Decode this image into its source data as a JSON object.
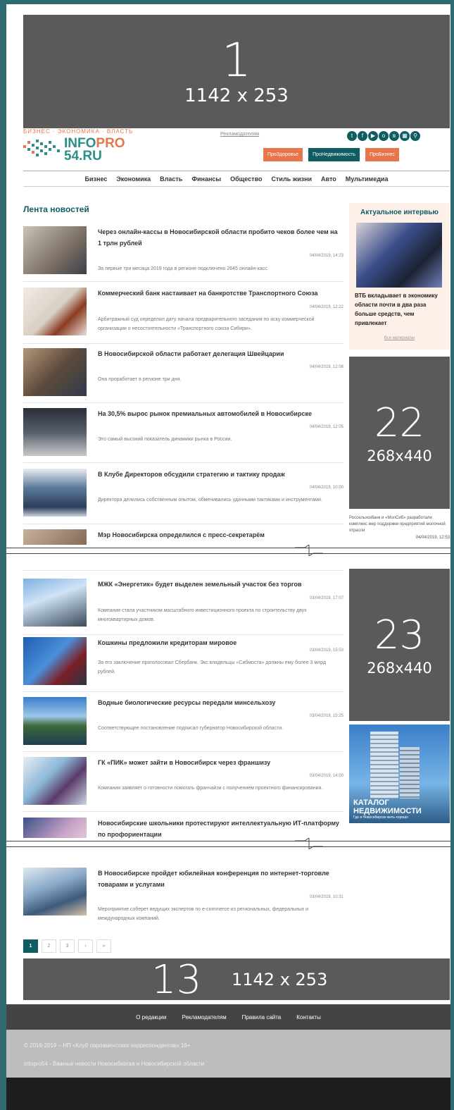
{
  "banners": {
    "top": {
      "number": "1",
      "size": "1142 x 253"
    },
    "side1": {
      "number": "22",
      "size": "268x440"
    },
    "side2": {
      "number": "23",
      "size": "268x440"
    },
    "bottom": {
      "number": "13",
      "size": "1142 x 253"
    }
  },
  "header": {
    "tagline": "БИЗНЕС · ЭКОНОМИКА · ВЛАСТЬ",
    "logo_line1_a": "INFO",
    "logo_line1_b": "PRO",
    "logo_line2": "54.RU",
    "adv_link": "Рекламодателям",
    "social_icons": [
      "twitter-icon",
      "facebook-icon",
      "youtube-icon",
      "odnoklassniki-icon",
      "vk-icon",
      "calendar-icon",
      "search-icon"
    ],
    "rubric_buttons": [
      "ПроЗдоровье",
      "ПроНедвижимость",
      "ПроБизнес"
    ]
  },
  "nav": [
    "Бизнес",
    "Экономика",
    "Власть",
    "Финансы",
    "Общество",
    "Стиль жизни",
    "Авто",
    "Мультимедиа"
  ],
  "feed_title": "Лента новостей",
  "news": [
    {
      "title": "Через онлайн-кассы в Новосибирской области пробито чеков более чем на 1 трлн рублей",
      "date": "04/04/2019, 14:23",
      "lead": "За первые три месяца 2019 года в регионе подключено 2645 онлайн-касс."
    },
    {
      "title": "Коммерческий банк настаивает на банкротстве Транспортного Союза",
      "date": "04/04/2019, 12:22",
      "lead": "Арбитражный суд определил дату начала предварительного заседания по иску коммерческой организации о несостоятельности «Транспортного союза Сибири»."
    },
    {
      "title": "В Новосибирской области работает делегация Швейцарии",
      "date": "04/04/2019, 12:08",
      "lead": "Она проработает в регионе три дня."
    },
    {
      "title": "На 30,5% вырос рынок премиальных автомобилей в Новосибирске",
      "date": "04/04/2019, 12:05",
      "lead": "Это самый высокий показатель динамики рынка в России."
    },
    {
      "title": "В Клубе Директоров обсудили стратегию и тактику продаж",
      "date": "04/04/2019, 10:00",
      "lead": "Директора делились собственным опытом, обменивались удачными тактиками и инструментами."
    },
    {
      "title": "Мэр Новосибирска определился с пресс-секретарём",
      "date": "",
      "lead": ""
    },
    {
      "title": "МЖК «Энергетик» будет выделен земельный участок без торгов",
      "date": "03/04/2019, 17:07",
      "lead": "Компания стала участником масштабного инвестиционного проекта по строительству двух многоквартирных домов."
    },
    {
      "title": "Кошкины предложили кредиторам мировое",
      "date": "03/04/2019, 15:53",
      "lead": "За его заключение проголосовал Сбербанк. Экс владельцы «Сибмоста» должны ему более 3 млрд рублей."
    },
    {
      "title": "Водные биологические ресурсы передали минсельхозу",
      "date": "03/04/2019, 15:25",
      "lead": "Соответствующее постановление подписал губернатор Новосибирской области."
    },
    {
      "title": "ГК «ПИК» может зайти в Новосибирск через франшизу",
      "date": "03/04/2019, 14:00",
      "lead": "Компания заявляет о готовности помогать франчайзи с получением проектного финансирования."
    },
    {
      "title": "Новосибирские школьники протестируют интеллектуальную ИТ-платформу по профориентации",
      "date": "",
      "lead": ""
    },
    {
      "title": "В Новосибирске пройдет юбилейная конференция по интернет-торговле товарами и услугами",
      "date": "03/04/2019, 10:31",
      "lead": "Мероприятие соберет ведущих экспертов по e-commerce из региональных, федеральных и международных компаний."
    }
  ],
  "interview": {
    "heading": "Актуальное интервью",
    "text": "ВТБ вкладывает в экономику области почти в два раза больше средств, чем привлекает",
    "all_link": "Все материалы"
  },
  "side_news": {
    "text": "Россельхозбанк и «МолСиб» разработали комплекс мер поддержки предприятий молочной отрасли",
    "date": "04/04/2019, 12:53"
  },
  "realty_ad": {
    "line1": "КАТАЛОГ",
    "line2": "НЕДВИЖИМОСТИ",
    "line3": "Где в Новосибирске жить хорошо"
  },
  "pagination": [
    "1",
    "2",
    "3",
    "›",
    "»"
  ],
  "footer": {
    "links": [
      "О редакции",
      "Рекламодателям",
      "Правила сайта",
      "Контакты"
    ],
    "copyright": "© 2016-2019 – НП «Клуб парламентских корреспондентов» 16+",
    "description": "Infopro54 - Важные новости Новосибирска и Новосибирской области"
  },
  "colors": {
    "accent": "#0f5c62",
    "orange": "#e8764a",
    "frame": "#2e6b73",
    "banner": "#5a5a5a"
  }
}
